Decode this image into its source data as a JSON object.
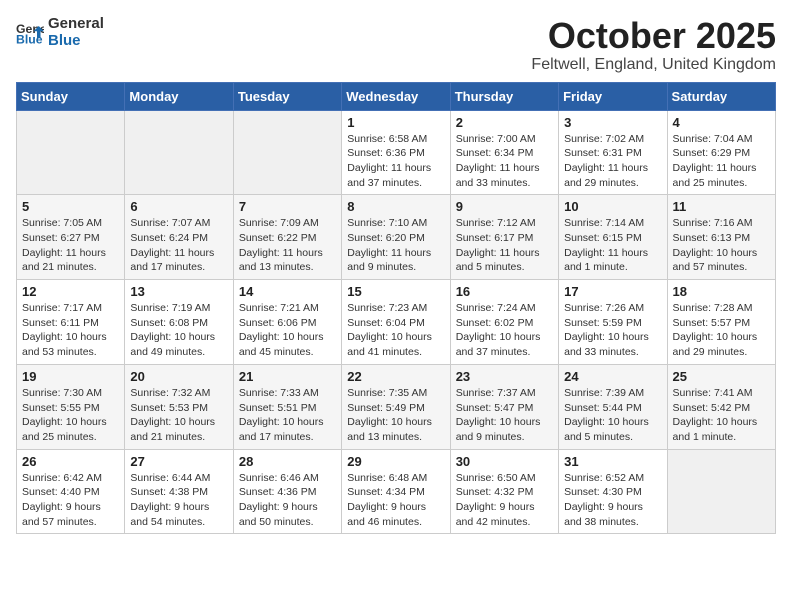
{
  "header": {
    "logo_general": "General",
    "logo_blue": "Blue",
    "month_title": "October 2025",
    "location": "Feltwell, England, United Kingdom"
  },
  "days_of_week": [
    "Sunday",
    "Monday",
    "Tuesday",
    "Wednesday",
    "Thursday",
    "Friday",
    "Saturday"
  ],
  "weeks": [
    [
      {
        "day": "",
        "info": ""
      },
      {
        "day": "",
        "info": ""
      },
      {
        "day": "",
        "info": ""
      },
      {
        "day": "1",
        "info": "Sunrise: 6:58 AM\nSunset: 6:36 PM\nDaylight: 11 hours\nand 37 minutes."
      },
      {
        "day": "2",
        "info": "Sunrise: 7:00 AM\nSunset: 6:34 PM\nDaylight: 11 hours\nand 33 minutes."
      },
      {
        "day": "3",
        "info": "Sunrise: 7:02 AM\nSunset: 6:31 PM\nDaylight: 11 hours\nand 29 minutes."
      },
      {
        "day": "4",
        "info": "Sunrise: 7:04 AM\nSunset: 6:29 PM\nDaylight: 11 hours\nand 25 minutes."
      }
    ],
    [
      {
        "day": "5",
        "info": "Sunrise: 7:05 AM\nSunset: 6:27 PM\nDaylight: 11 hours\nand 21 minutes."
      },
      {
        "day": "6",
        "info": "Sunrise: 7:07 AM\nSunset: 6:24 PM\nDaylight: 11 hours\nand 17 minutes."
      },
      {
        "day": "7",
        "info": "Sunrise: 7:09 AM\nSunset: 6:22 PM\nDaylight: 11 hours\nand 13 minutes."
      },
      {
        "day": "8",
        "info": "Sunrise: 7:10 AM\nSunset: 6:20 PM\nDaylight: 11 hours\nand 9 minutes."
      },
      {
        "day": "9",
        "info": "Sunrise: 7:12 AM\nSunset: 6:17 PM\nDaylight: 11 hours\nand 5 minutes."
      },
      {
        "day": "10",
        "info": "Sunrise: 7:14 AM\nSunset: 6:15 PM\nDaylight: 11 hours\nand 1 minute."
      },
      {
        "day": "11",
        "info": "Sunrise: 7:16 AM\nSunset: 6:13 PM\nDaylight: 10 hours\nand 57 minutes."
      }
    ],
    [
      {
        "day": "12",
        "info": "Sunrise: 7:17 AM\nSunset: 6:11 PM\nDaylight: 10 hours\nand 53 minutes."
      },
      {
        "day": "13",
        "info": "Sunrise: 7:19 AM\nSunset: 6:08 PM\nDaylight: 10 hours\nand 49 minutes."
      },
      {
        "day": "14",
        "info": "Sunrise: 7:21 AM\nSunset: 6:06 PM\nDaylight: 10 hours\nand 45 minutes."
      },
      {
        "day": "15",
        "info": "Sunrise: 7:23 AM\nSunset: 6:04 PM\nDaylight: 10 hours\nand 41 minutes."
      },
      {
        "day": "16",
        "info": "Sunrise: 7:24 AM\nSunset: 6:02 PM\nDaylight: 10 hours\nand 37 minutes."
      },
      {
        "day": "17",
        "info": "Sunrise: 7:26 AM\nSunset: 5:59 PM\nDaylight: 10 hours\nand 33 minutes."
      },
      {
        "day": "18",
        "info": "Sunrise: 7:28 AM\nSunset: 5:57 PM\nDaylight: 10 hours\nand 29 minutes."
      }
    ],
    [
      {
        "day": "19",
        "info": "Sunrise: 7:30 AM\nSunset: 5:55 PM\nDaylight: 10 hours\nand 25 minutes."
      },
      {
        "day": "20",
        "info": "Sunrise: 7:32 AM\nSunset: 5:53 PM\nDaylight: 10 hours\nand 21 minutes."
      },
      {
        "day": "21",
        "info": "Sunrise: 7:33 AM\nSunset: 5:51 PM\nDaylight: 10 hours\nand 17 minutes."
      },
      {
        "day": "22",
        "info": "Sunrise: 7:35 AM\nSunset: 5:49 PM\nDaylight: 10 hours\nand 13 minutes."
      },
      {
        "day": "23",
        "info": "Sunrise: 7:37 AM\nSunset: 5:47 PM\nDaylight: 10 hours\nand 9 minutes."
      },
      {
        "day": "24",
        "info": "Sunrise: 7:39 AM\nSunset: 5:44 PM\nDaylight: 10 hours\nand 5 minutes."
      },
      {
        "day": "25",
        "info": "Sunrise: 7:41 AM\nSunset: 5:42 PM\nDaylight: 10 hours\nand 1 minute."
      }
    ],
    [
      {
        "day": "26",
        "info": "Sunrise: 6:42 AM\nSunset: 4:40 PM\nDaylight: 9 hours\nand 57 minutes."
      },
      {
        "day": "27",
        "info": "Sunrise: 6:44 AM\nSunset: 4:38 PM\nDaylight: 9 hours\nand 54 minutes."
      },
      {
        "day": "28",
        "info": "Sunrise: 6:46 AM\nSunset: 4:36 PM\nDaylight: 9 hours\nand 50 minutes."
      },
      {
        "day": "29",
        "info": "Sunrise: 6:48 AM\nSunset: 4:34 PM\nDaylight: 9 hours\nand 46 minutes."
      },
      {
        "day": "30",
        "info": "Sunrise: 6:50 AM\nSunset: 4:32 PM\nDaylight: 9 hours\nand 42 minutes."
      },
      {
        "day": "31",
        "info": "Sunrise: 6:52 AM\nSunset: 4:30 PM\nDaylight: 9 hours\nand 38 minutes."
      },
      {
        "day": "",
        "info": ""
      }
    ]
  ]
}
